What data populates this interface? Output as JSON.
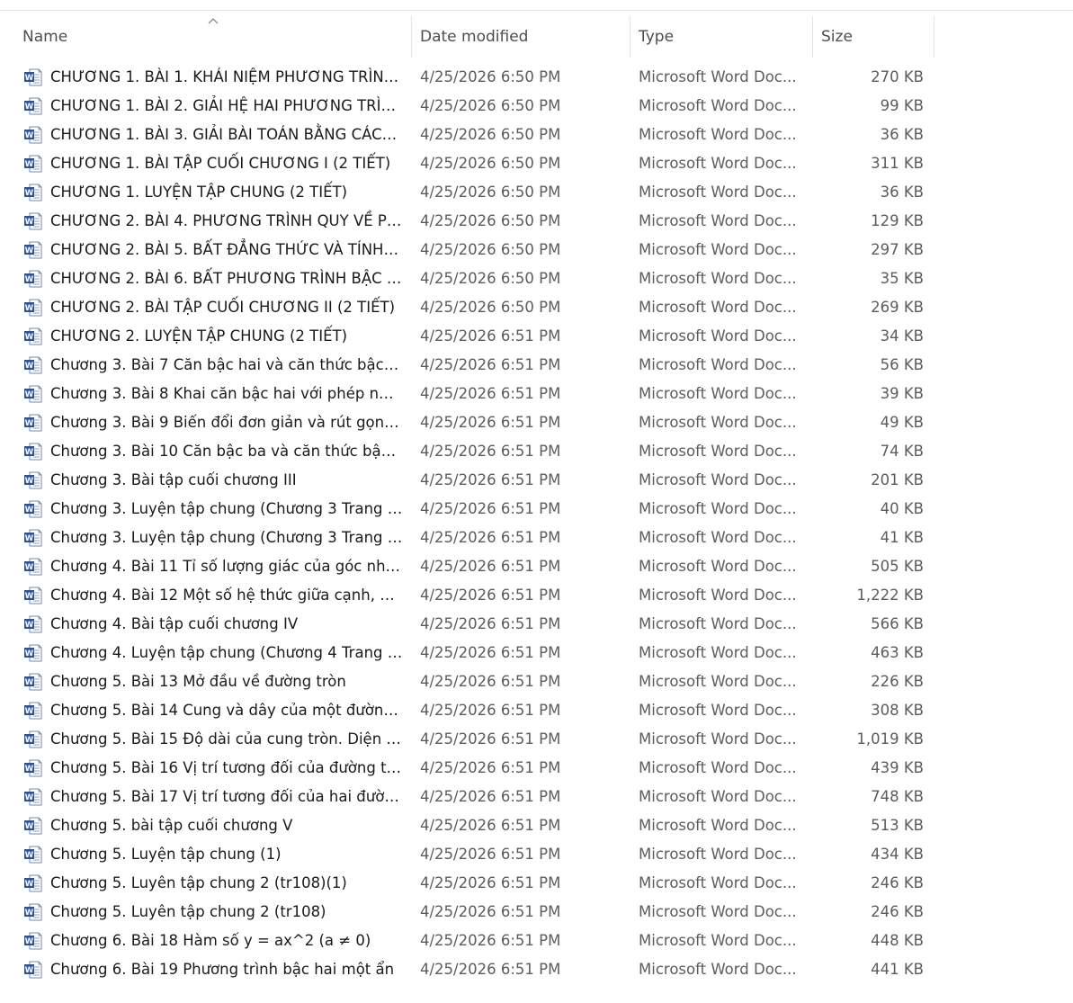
{
  "columns": {
    "name": "Name",
    "date": "Date modified",
    "type": "Type",
    "size": "Size"
  },
  "icons": {
    "file": "word-doc-icon",
    "sort": "sort-ascending-icon",
    "accent": "#2b579a"
  },
  "files": [
    {
      "name": "CHƯƠNG 1. BÀI 1. KHÁI NIỆM PHƯƠNG TRÌNH...",
      "date": "4/25/2026 6:50 PM",
      "type": "Microsoft Word Doc...",
      "size": "270 KB"
    },
    {
      "name": "CHƯƠNG 1. BÀI 2. GIẢI HỆ HAI PHƯƠNG TRÌN...",
      "date": "4/25/2026 6:50 PM",
      "type": "Microsoft Word Doc...",
      "size": "99 KB"
    },
    {
      "name": "CHƯƠNG 1. BÀI 3. GIẢI BÀI TOÁN BẰNG CÁCH ...",
      "date": "4/25/2026 6:50 PM",
      "type": "Microsoft Word Doc...",
      "size": "36 KB"
    },
    {
      "name": "CHƯƠNG 1. BÀI TẬP CUỐI CHƯƠNG I (2 TIẾT)",
      "date": "4/25/2026 6:50 PM",
      "type": "Microsoft Word Doc...",
      "size": "311 KB"
    },
    {
      "name": "CHƯƠNG 1. LUYỆN TẬP CHUNG (2 TIẾT)",
      "date": "4/25/2026 6:50 PM",
      "type": "Microsoft Word Doc...",
      "size": "36 KB"
    },
    {
      "name": "CHƯƠNG 2. BÀI 4. PHƯƠNG TRÌNH QUY VỀ PH...",
      "date": "4/25/2026 6:50 PM",
      "type": "Microsoft Word Doc...",
      "size": "129 KB"
    },
    {
      "name": "CHƯƠNG 2. BÀI 5. BẤT ĐẲNG THỨC VÀ TÍNH C...",
      "date": "4/25/2026 6:50 PM",
      "type": "Microsoft Word Doc...",
      "size": "297 KB"
    },
    {
      "name": "CHƯƠNG 2. BÀI 6. BẤT PHƯƠNG TRÌNH BẬC N...",
      "date": "4/25/2026 6:50 PM",
      "type": "Microsoft Word Doc...",
      "size": "35 KB"
    },
    {
      "name": "CHƯƠNG 2. BÀI TẬP CUỐI CHƯƠNG II (2 TIẾT)",
      "date": "4/25/2026 6:50 PM",
      "type": "Microsoft Word Doc...",
      "size": "269 KB"
    },
    {
      "name": "CHƯƠNG 2. LUYỆN TẬP CHUNG (2 TIẾT)",
      "date": "4/25/2026 6:51 PM",
      "type": "Microsoft Word Doc...",
      "size": "34 KB"
    },
    {
      "name": "Chương 3. Bài 7 Căn bậc hai và căn thức bậc hai...",
      "date": "4/25/2026 6:51 PM",
      "type": "Microsoft Word Doc...",
      "size": "56 KB"
    },
    {
      "name": "Chương 3. Bài 8 Khai căn bậc hai với phép nhân...",
      "date": "4/25/2026 6:51 PM",
      "type": "Microsoft Word Doc...",
      "size": "39 KB"
    },
    {
      "name": "Chương 3. Bài 9 Biến đổi đơn giản và rút gọn bi...",
      "date": "4/25/2026 6:51 PM",
      "type": "Microsoft Word Doc...",
      "size": "49 KB"
    },
    {
      "name": "Chương 3. Bài 10 Căn bậc ba và căn thức bậc b...",
      "date": "4/25/2026 6:51 PM",
      "type": "Microsoft Word Doc...",
      "size": "74 KB"
    },
    {
      "name": "Chương 3. Bài tập cuối chương III",
      "date": "4/25/2026 6:51 PM",
      "type": "Microsoft Word Doc...",
      "size": "201 KB"
    },
    {
      "name": "Chương 3. Luyện tập chung (Chương 3 Trang 52)",
      "date": "4/25/2026 6:51 PM",
      "type": "Microsoft Word Doc...",
      "size": "40 KB"
    },
    {
      "name": "Chương 3. Luyện tập chung (Chương 3 Trang 63)",
      "date": "4/25/2026 6:51 PM",
      "type": "Microsoft Word Doc...",
      "size": "41 KB"
    },
    {
      "name": "Chương 4. Bài 11 Tỉ số lượng giác của góc nhọn",
      "date": "4/25/2026 6:51 PM",
      "type": "Microsoft Word Doc...",
      "size": "505 KB"
    },
    {
      "name": "Chương 4. Bài 12 Một số hệ thức giữa cạnh, gó...",
      "date": "4/25/2026 6:51 PM",
      "type": "Microsoft Word Doc...",
      "size": "1,222 KB"
    },
    {
      "name": "Chương 4. Bài tập cuối chương IV",
      "date": "4/25/2026 6:51 PM",
      "type": "Microsoft Word Doc...",
      "size": "566 KB"
    },
    {
      "name": "Chương 4. Luyện tập chung (Chương 4 Trang 79)",
      "date": "4/25/2026 6:51 PM",
      "type": "Microsoft Word Doc...",
      "size": "463 KB"
    },
    {
      "name": "Chương 5. Bài 13 Mở đầu về đường tròn",
      "date": "4/25/2026 6:51 PM",
      "type": "Microsoft Word Doc...",
      "size": "226 KB"
    },
    {
      "name": "Chương 5. Bài 14 Cung và dây của một đường ...",
      "date": "4/25/2026 6:51 PM",
      "type": "Microsoft Word Doc...",
      "size": "308 KB"
    },
    {
      "name": "Chương 5. Bài 15 Độ dài của cung tròn. Diện tíc...",
      "date": "4/25/2026 6:51 PM",
      "type": "Microsoft Word Doc...",
      "size": "1,019 KB"
    },
    {
      "name": "Chương 5. Bài 16 Vị trí tương đối của đường th...",
      "date": "4/25/2026 6:51 PM",
      "type": "Microsoft Word Doc...",
      "size": "439 KB"
    },
    {
      "name": "Chương 5. Bài 17 Vị trí tương đối của hai đườn...",
      "date": "4/25/2026 6:51 PM",
      "type": "Microsoft Word Doc...",
      "size": "748 KB"
    },
    {
      "name": "Chương 5. bài tập cuối chương V",
      "date": "4/25/2026 6:51 PM",
      "type": "Microsoft Word Doc...",
      "size": "513 KB"
    },
    {
      "name": "Chương 5. Luyện tập chung (1)",
      "date": "4/25/2026 6:51 PM",
      "type": "Microsoft Word Doc...",
      "size": "434 KB"
    },
    {
      "name": "Chương 5. Luyên tập chung 2 (tr108)(1)",
      "date": "4/25/2026 6:51 PM",
      "type": "Microsoft Word Doc...",
      "size": "246 KB"
    },
    {
      "name": "Chương 5. Luyên tập chung 2 (tr108)",
      "date": "4/25/2026 6:51 PM",
      "type": "Microsoft Word Doc...",
      "size": "246 KB"
    },
    {
      "name": "Chương 6. Bài 18 Hàm số y = ax^2 (a ≠ 0)",
      "date": "4/25/2026 6:51 PM",
      "type": "Microsoft Word Doc...",
      "size": "448 KB"
    },
    {
      "name": "Chương 6. Bài 19 Phương trình bậc hai một ẩn",
      "date": "4/25/2026 6:51 PM",
      "type": "Microsoft Word Doc...",
      "size": "441 KB"
    }
  ]
}
